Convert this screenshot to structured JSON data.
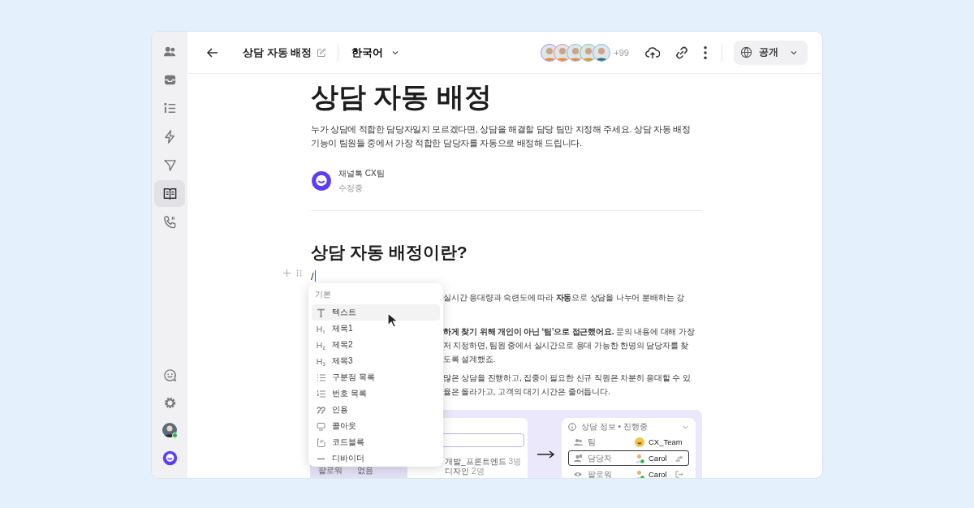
{
  "sidebar": {
    "items": [
      {
        "kind": "people",
        "selected": false
      },
      {
        "kind": "inbox",
        "selected": false
      },
      {
        "kind": "list",
        "selected": false
      },
      {
        "kind": "bolt",
        "selected": false
      },
      {
        "kind": "send",
        "selected": false
      },
      {
        "kind": "book",
        "selected": true
      },
      {
        "kind": "phone",
        "selected": false
      }
    ],
    "bottom": [
      {
        "kind": "chat"
      },
      {
        "kind": "gear"
      },
      {
        "kind": "avatar",
        "online": true
      },
      {
        "kind": "logo"
      }
    ]
  },
  "header": {
    "title": "상담 자동 배정",
    "language": "한국어",
    "avatars": [
      {
        "color": "#a98af0"
      },
      {
        "color": "#ef8a8a"
      },
      {
        "color": "#86b8ee"
      },
      {
        "color": "#7cc795"
      },
      {
        "color": "#86b8ee"
      }
    ],
    "more_count": "+99",
    "visibility": "공개"
  },
  "document": {
    "title": "상담 자동 배정",
    "description": "누가 상담에 적합한 담당자일지 모르겠다면, 상담을 해결할 담당 팀만 지정해 주세요. 상담 자동 배정 기능이 팀원들 중에서 가장 적합한 담당자를 자동으로 배정해 드립니다.",
    "author": {
      "name": "채널톡 CX팀",
      "status": "수정중"
    },
    "heading": "상담 자동 배정이란?",
    "input": "/",
    "paragraphs": [
      [
        "실시간 응대량과 숙련도에 따라 **자동**으로 상담을 나누어 분배하는 강"
      ],
      [
        "**하게 찾기 위해 개인이 아닌 ‘팀'으로 접근했어요.** 문의 내용에 대해 가장",
        "저 지정하면, 팀원 중에서 실시간으로 응대 가능한 한명의 담당자를 찾",
        "도록 설계했죠."
      ],
      [
        "많은 상담을 진행하고, 집중이 필요한 신규 직원은 차분히 응대할 수 있",
        "율은 올라가고, 고객의 대기 시간은 줄어듭니다."
      ]
    ],
    "figure": {
      "left_list": [
        {
          "name": "개발_프론트엔드",
          "count": "3명"
        },
        {
          "name": "디자인",
          "count": "2명"
        }
      ],
      "left_row": {
        "label": "팔로워",
        "value": "없음"
      },
      "card": {
        "title": "상담 정보 • 진행중",
        "rows": [
          {
            "kind": "team",
            "label": "팀",
            "value": "CX_Team",
            "selected": false
          },
          {
            "kind": "assignee",
            "label": "담당자",
            "value": "Carol",
            "selected": true
          },
          {
            "kind": "follower",
            "label": "팔로워",
            "value": "Carol",
            "selected": false
          }
        ]
      }
    }
  },
  "block_menu": {
    "section": "기본",
    "items": [
      {
        "kind": "text",
        "label": "텍스트",
        "selected": true
      },
      {
        "kind": "h1",
        "label": "제목1",
        "selected": false
      },
      {
        "kind": "h2",
        "label": "제목2",
        "selected": false
      },
      {
        "kind": "h3",
        "label": "제목3",
        "selected": false
      },
      {
        "kind": "bullet",
        "label": "구분점 목록",
        "selected": false
      },
      {
        "kind": "number",
        "label": "번호 목록",
        "selected": false
      },
      {
        "kind": "quote",
        "label": "인용",
        "selected": false
      },
      {
        "kind": "callout",
        "label": "콜아웃",
        "selected": false
      },
      {
        "kind": "code",
        "label": "코드블록",
        "selected": false
      },
      {
        "kind": "divider",
        "label": "디바이더",
        "selected": false
      }
    ]
  }
}
